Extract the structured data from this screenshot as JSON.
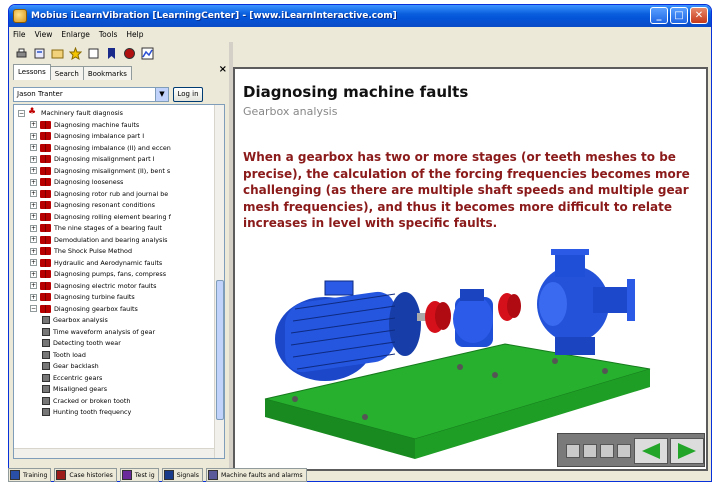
{
  "window": {
    "title": "Mobius iLearnVibration [LearningCenter] - [www.iLearnInteractive.com]",
    "minimize_glyph": "_",
    "maximize_glyph": "□",
    "close_glyph": "✕"
  },
  "menu": [
    "File",
    "View",
    "Enlarge",
    "Tools",
    "Help"
  ],
  "toolbar_icons": [
    "print-icon",
    "preview-icon",
    "folder-icon",
    "favorite-star-icon",
    "frame-icon",
    "bookmark-icon",
    "record-icon",
    "graph-icon"
  ],
  "left_panel": {
    "tabs": [
      "Lessons",
      "Search",
      "Bookmarks"
    ],
    "close_glyph": "×",
    "user": "Jason Tranter",
    "login_label": "Log in",
    "tree": [
      {
        "label": "Machinery fault diagnosis",
        "level": 0,
        "kind": "root",
        "exp": "−"
      },
      {
        "label": "Diagnosing machine faults",
        "level": 1,
        "kind": "book",
        "exp": "+"
      },
      {
        "label": "Diagnosing imbalance part I",
        "level": 1,
        "kind": "book",
        "exp": "+"
      },
      {
        "label": "Diagnosing imbalance (II) and eccen",
        "level": 1,
        "kind": "book",
        "exp": "+"
      },
      {
        "label": "Diagnosing misalignment part I",
        "level": 1,
        "kind": "book",
        "exp": "+"
      },
      {
        "label": "Diagnosing misalignment (II), bent s",
        "level": 1,
        "kind": "book",
        "exp": "+"
      },
      {
        "label": "Diagnosing looseness",
        "level": 1,
        "kind": "book",
        "exp": "+"
      },
      {
        "label": "Diagnosing rotor rub and journal be",
        "level": 1,
        "kind": "book",
        "exp": "+"
      },
      {
        "label": "Diagnosing resonant conditions",
        "level": 1,
        "kind": "book",
        "exp": "+"
      },
      {
        "label": "Diagnosing rolling element bearing f",
        "level": 1,
        "kind": "book",
        "exp": "+"
      },
      {
        "label": "The nine stages of a bearing fault",
        "level": 1,
        "kind": "book",
        "exp": "+"
      },
      {
        "label": "Demodulation and bearing analysis",
        "level": 1,
        "kind": "book",
        "exp": "+"
      },
      {
        "label": "The Shock Pulse Method",
        "level": 1,
        "kind": "book",
        "exp": "+"
      },
      {
        "label": "Hydraulic and Aerodynamic faults",
        "level": 1,
        "kind": "book",
        "exp": "+"
      },
      {
        "label": "Diagnosing pumps, fans, compress",
        "level": 1,
        "kind": "book",
        "exp": "+"
      },
      {
        "label": "Diagnosing electric motor faults",
        "level": 1,
        "kind": "book",
        "exp": "+"
      },
      {
        "label": "Diagnosing turbine faults",
        "level": 1,
        "kind": "book",
        "exp": "+"
      },
      {
        "label": "Diagnosing gearbox faults",
        "level": 1,
        "kind": "book",
        "exp": "−"
      },
      {
        "label": "Gearbox analysis",
        "level": 2,
        "kind": "page",
        "exp": ""
      },
      {
        "label": "Time waveform analysis of gear",
        "level": 2,
        "kind": "page",
        "exp": ""
      },
      {
        "label": "Detecting tooth wear",
        "level": 2,
        "kind": "page",
        "exp": ""
      },
      {
        "label": "Tooth load",
        "level": 2,
        "kind": "page",
        "exp": ""
      },
      {
        "label": "Gear backlash",
        "level": 2,
        "kind": "page",
        "exp": ""
      },
      {
        "label": "Eccentric gears",
        "level": 2,
        "kind": "page",
        "exp": ""
      },
      {
        "label": "Misaligned gears",
        "level": 2,
        "kind": "page",
        "exp": ""
      },
      {
        "label": "Cracked or broken tooth",
        "level": 2,
        "kind": "page",
        "exp": ""
      },
      {
        "label": "Hunting tooth frequency",
        "level": 2,
        "kind": "page",
        "exp": ""
      }
    ]
  },
  "content": {
    "title": "Diagnosing machine faults",
    "subtitle": "Gearbox analysis",
    "body": "When a gearbox has two or more stages (or teeth meshes to be precise), the calculation of the forcing frequencies becomes more challenging (as there are multiple shaft speeds and multiple gear mesh frequencies), and thus it becomes more difficult to relate increases in level with specific faults."
  },
  "bottom_tabs": [
    {
      "label": "Training",
      "color": "#2a4fa8"
    },
    {
      "label": "Case histories",
      "color": "#9b1a1a"
    },
    {
      "label": "Test ig",
      "color": "#6a2a9b"
    },
    {
      "label": "Signals",
      "color": "#1a3a8a"
    },
    {
      "label": "Machine faults and alarms",
      "color": "#5a5a9b"
    }
  ],
  "colors": {
    "body_text": "#8b1a1a",
    "motor": "#1f4fd6",
    "base": "#22a52a",
    "coupling": "#d6101a",
    "nav_arrow": "#23a52a"
  }
}
